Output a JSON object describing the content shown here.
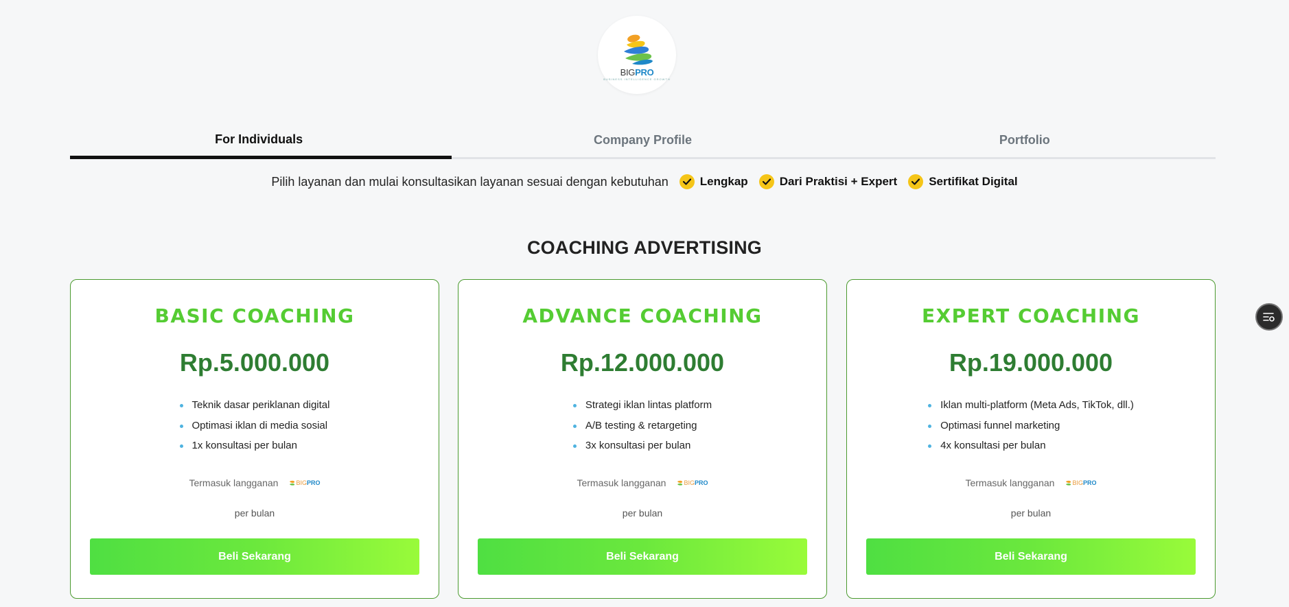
{
  "brand": {
    "logo_big": "BIG",
    "logo_pro": "PRO",
    "logo_tagline": "BUSINESS INTELLIGENCE GROWTH",
    "colors": {
      "accent_green": "#55cc33",
      "price_green": "#2e7d32",
      "check_yellow": "#f5c518",
      "logo_blue": "#1e88c8"
    }
  },
  "tabs": [
    {
      "label": "For Individuals",
      "active": true
    },
    {
      "label": "Company Profile",
      "active": false
    },
    {
      "label": "Portfolio",
      "active": false
    }
  ],
  "info": {
    "lead": "Pilih layanan dan mulai konsultasikan layanan sesuai dengan kebutuhan",
    "features": [
      "Lengkap",
      "Dari Praktisi + Expert",
      "Sertifikat Digital"
    ]
  },
  "section_title": "COACHING ADVERTISING",
  "plans": [
    {
      "title": "BASIC COACHING",
      "price": "Rp.5.000.000",
      "features": [
        "Teknik dasar periklanan digital",
        "Optimasi iklan di media sosial",
        "1x konsultasi per bulan"
      ],
      "included_label": "Termasuk langganan",
      "period": "per bulan",
      "button": "Beli Sekarang"
    },
    {
      "title": "ADVANCE COACHING",
      "price": "Rp.12.000.000",
      "features": [
        "Strategi iklan lintas platform",
        "A/B testing & retargeting",
        "3x konsultasi per bulan"
      ],
      "included_label": "Termasuk langganan",
      "period": "per bulan",
      "button": "Beli Sekarang"
    },
    {
      "title": "EXPERT COACHING",
      "price": "Rp.19.000.000",
      "features": [
        "Iklan multi-platform (Meta Ads, TikTok, dll.)",
        "Optimasi funnel marketing",
        "4x konsultasi per bulan"
      ],
      "included_label": "Termasuk langganan",
      "period": "per bulan",
      "button": "Beli Sekarang"
    }
  ],
  "floating_button_icon": "list-settings-icon"
}
